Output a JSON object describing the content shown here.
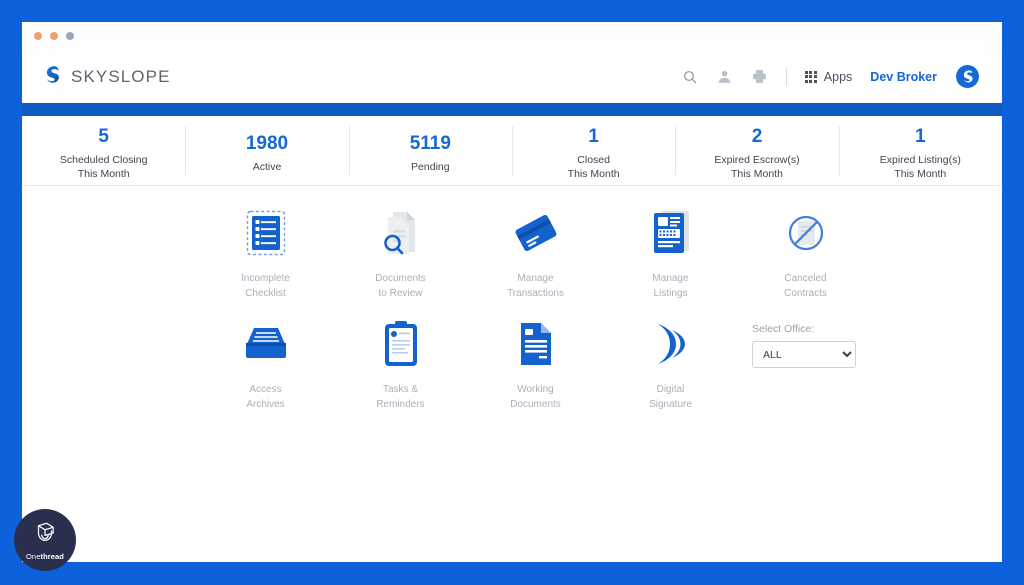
{
  "window": {
    "dots": [
      "close-dot",
      "minimize-dot",
      "maximize-dot"
    ]
  },
  "header": {
    "brand_name": "SKYSLOPE",
    "logo_icon": "skyslope-swoosh-icon",
    "search_icon": "search-icon",
    "contacts_icon": "contacts-icon",
    "print_icon": "print-icon",
    "apps_icon": "apps-grid-icon",
    "apps_label": "Apps",
    "user_name": "Dev Broker",
    "user_logo_icon": "skyslope-circle-logo-icon",
    "nav_bar_color": "#0c5cc4"
  },
  "stats": [
    {
      "value": "5",
      "label": "Scheduled Closing\nThis Month",
      "line1": "Scheduled Closing",
      "line2": "This Month"
    },
    {
      "value": "1980",
      "label": "Active",
      "line1": "Active",
      "line2": ""
    },
    {
      "value": "5119",
      "label": "Pending",
      "line1": "Pending",
      "line2": ""
    },
    {
      "value": "1",
      "label": "Closed\nThis Month",
      "line1": "Closed",
      "line2": "This Month"
    },
    {
      "value": "2",
      "label": "Expired Escrow(s)\nThis Month",
      "line1": "Expired Escrow(s)",
      "line2": "This Month"
    },
    {
      "value": "1",
      "label": "Expired Listing(s)\nThis Month",
      "line1": "Expired Listing(s)",
      "line2": "This Month"
    }
  ],
  "tiles": {
    "row1": [
      {
        "icon": "incomplete-checklist-icon",
        "line1": "Incomplete",
        "line2": "Checklist"
      },
      {
        "icon": "documents-to-review-icon",
        "line1": "Documents",
        "line2": "to Review"
      },
      {
        "icon": "manage-transactions-icon",
        "line1": "Manage",
        "line2": "Transactions"
      },
      {
        "icon": "manage-listings-icon",
        "line1": "Manage",
        "line2": "Listings"
      },
      {
        "icon": "canceled-contracts-icon",
        "line1": "Canceled",
        "line2": "Contracts"
      }
    ],
    "row2": [
      {
        "icon": "access-archives-icon",
        "line1": "Access",
        "line2": "Archives"
      },
      {
        "icon": "tasks-reminders-icon",
        "line1": "Tasks &",
        "line2": "Reminders"
      },
      {
        "icon": "working-documents-icon",
        "line1": "Working",
        "line2": "Documents"
      },
      {
        "icon": "digital-signature-icon",
        "line1": "Digital",
        "line2": "Signature"
      }
    ]
  },
  "office": {
    "label": "Select Office:",
    "selected": "ALL",
    "options": [
      "ALL"
    ]
  },
  "watermark": {
    "icon": "onethread-spool-icon",
    "text_light": "One",
    "text_bold": "thread"
  },
  "colors": {
    "frame_blue": "#0d62db",
    "nav_blue": "#0c5cc4",
    "accent_blue": "#1468d8",
    "icon_blue": "#1462cd",
    "muted_gray": "#a9b0ba"
  }
}
